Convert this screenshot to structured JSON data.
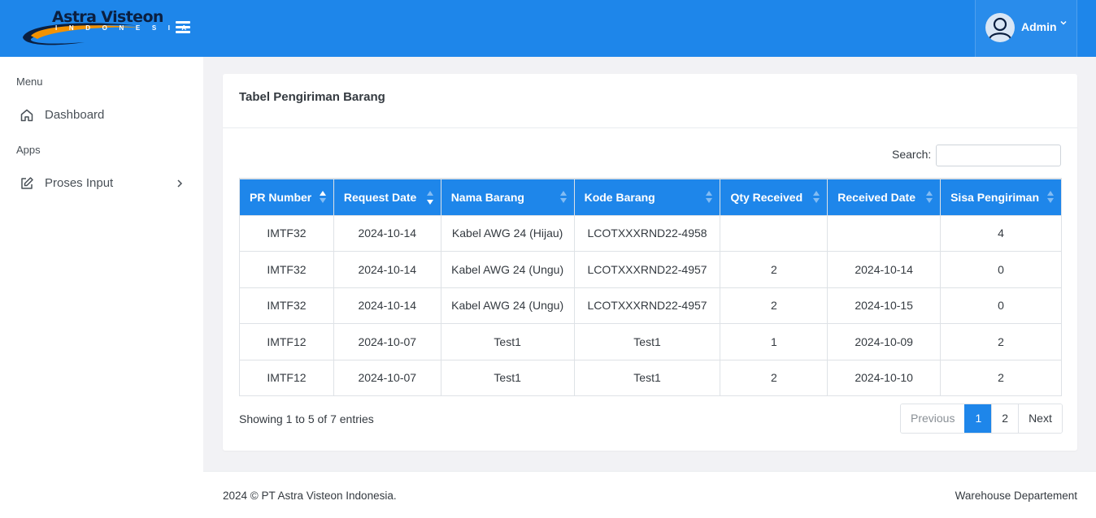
{
  "brand": {
    "name": "Astra Visteon",
    "sub": "I N D O N E S I A",
    "colors": {
      "primary": "#1e86ea",
      "logo_orange": "#f39200",
      "logo_navy": "#0b1f40"
    }
  },
  "header": {
    "user_name": "Admin",
    "user_caret": "⌄"
  },
  "sidebar": {
    "section_menu": "Menu",
    "section_apps": "Apps",
    "items": [
      {
        "label": "Dashboard",
        "icon": "home-icon"
      },
      {
        "label": "Proses Input",
        "icon": "edit-icon",
        "has_submenu": true
      }
    ]
  },
  "card": {
    "title": "Tabel Pengiriman Barang",
    "search_label": "Search:",
    "search_value": ""
  },
  "table": {
    "columns": [
      "PR Number",
      "Request Date",
      "Nama Barang",
      "Kode Barang",
      "Qty Received",
      "Received Date",
      "Sisa Pengiriman"
    ],
    "sorted_column": "PR Number",
    "sort_direction": "asc",
    "rows": [
      [
        "IMTF32",
        "2024-10-14",
        "Kabel AWG 24 (Hijau)",
        "LCOTXXXRND22-4958",
        "",
        "",
        "4"
      ],
      [
        "IMTF32",
        "2024-10-14",
        "Kabel AWG 24 (Ungu)",
        "LCOTXXXRND22-4957",
        "2",
        "2024-10-14",
        "0"
      ],
      [
        "IMTF32",
        "2024-10-14",
        "Kabel AWG 24 (Ungu)",
        "LCOTXXXRND22-4957",
        "2",
        "2024-10-15",
        "0"
      ],
      [
        "IMTF12",
        "2024-10-07",
        "Test1",
        "Test1",
        "1",
        "2024-10-09",
        "2"
      ],
      [
        "IMTF12",
        "2024-10-07",
        "Test1",
        "Test1",
        "2",
        "2024-10-10",
        "2"
      ]
    ],
    "info": "Showing 1 to 5 of 7 entries"
  },
  "pagination": {
    "previous": "Previous",
    "pages": [
      "1",
      "2"
    ],
    "current_page": "1",
    "next": "Next"
  },
  "footer": {
    "left": "2024 © PT Astra Visteon Indonesia.",
    "right": "Warehouse Departement"
  }
}
